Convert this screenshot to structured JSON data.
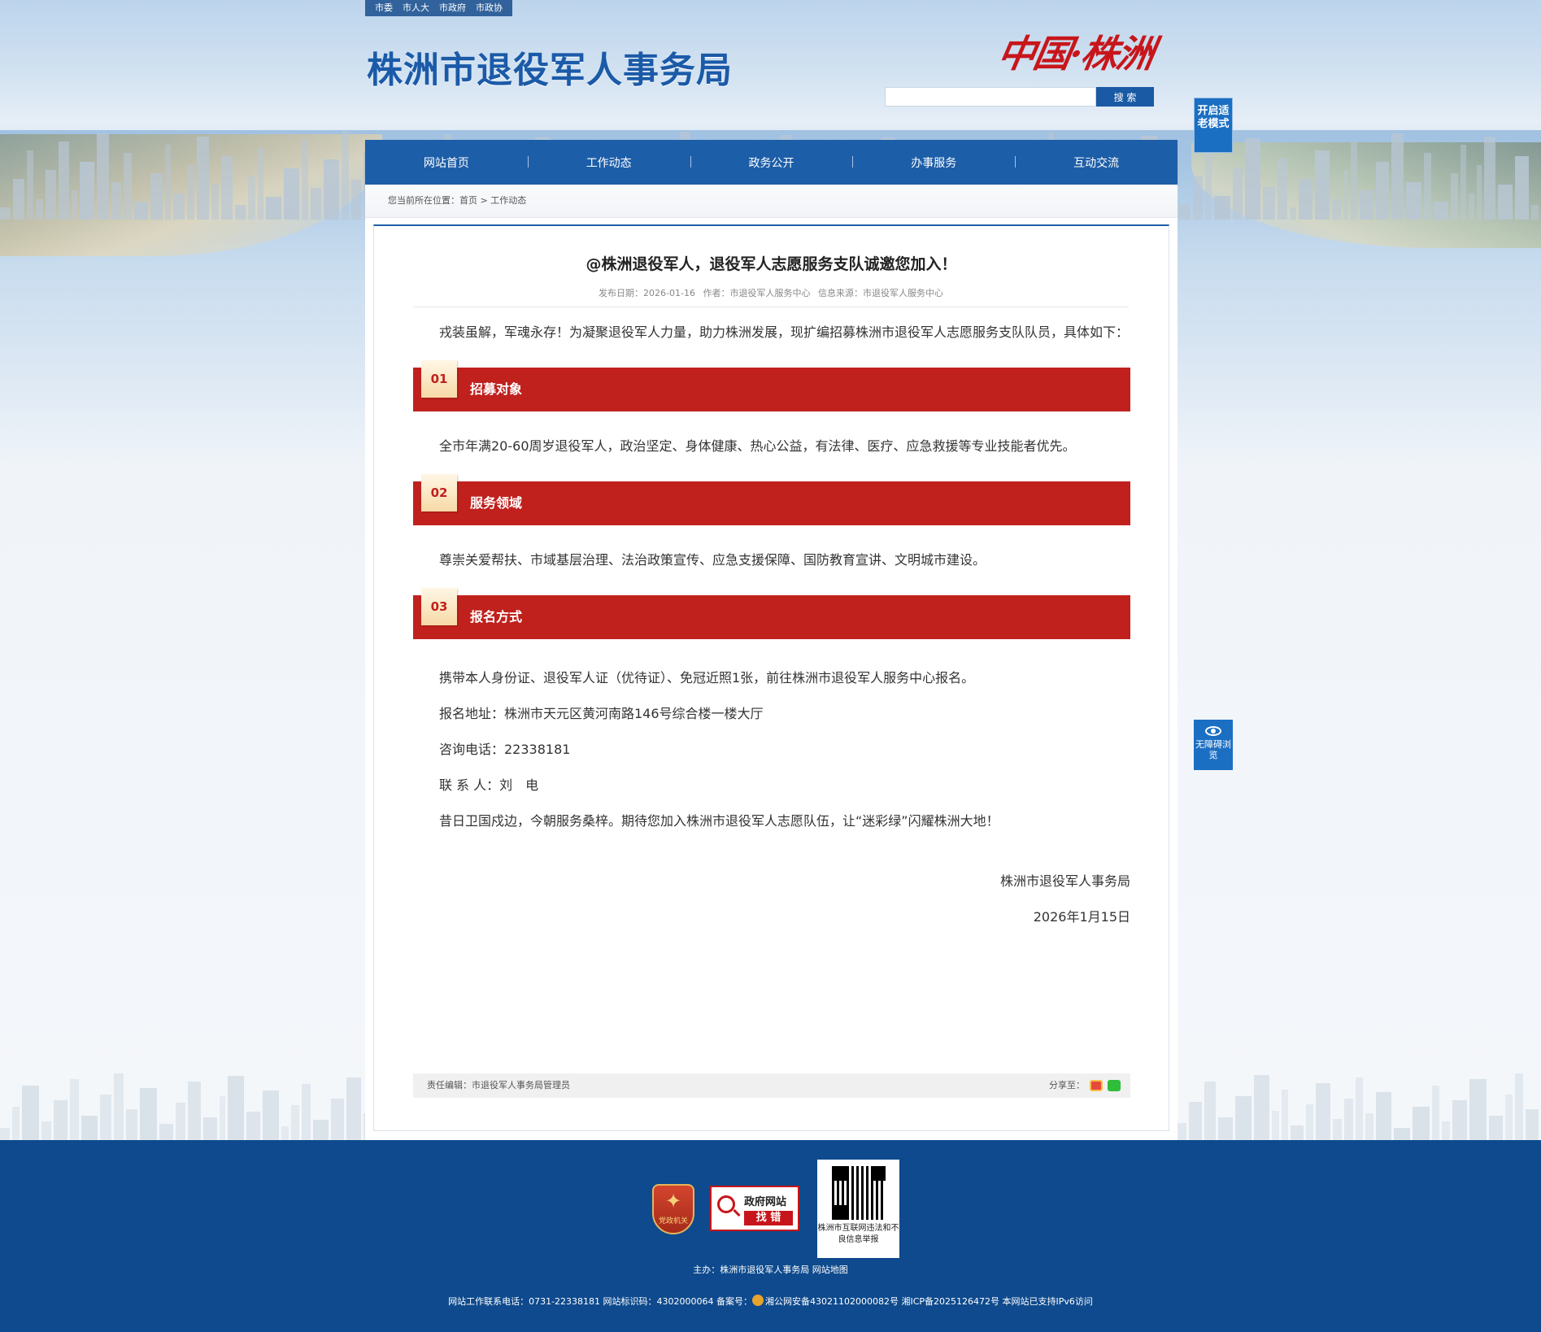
{
  "colors": {
    "brand_blue": "#1d5ea8",
    "accent_red": "#c0211d",
    "footer_blue": "#0e4a8d"
  },
  "top_links": [
    "市委",
    "市人大",
    "市政府",
    "市政协"
  ],
  "site_title": "株洲市退役军人事务局",
  "logo_text": "中国·株洲",
  "search": {
    "placeholder": "",
    "button": "搜 索"
  },
  "elder_mode": "开启适老模式",
  "nav": [
    "网站首页",
    "工作动态",
    "政务公开",
    "办事服务",
    "互动交流"
  ],
  "breadcrumb": {
    "prefix": "您当前所在位置：",
    "home": "首页",
    "sep": " > ",
    "current": "工作动态"
  },
  "article": {
    "title": "@株洲退役军人，退役军人志愿服务支队诚邀您加入！",
    "meta": {
      "date": "发布日期：2026-01-16",
      "author": "作者：市退役军人服务中心",
      "source": "信息来源：市退役军人服务中心"
    },
    "intro": "戎装虽解，军魂永存！为凝聚退役军人力量，助力株洲发展，现扩编招募株洲市退役军人志愿服务支队队员，具体如下：",
    "sections": [
      {
        "num": "01",
        "label": "招募对象",
        "text": "全市年满20-60周岁退役军人，政治坚定、身体健康、热心公益，有法律、医疗、应急救援等专业技能者优先。"
      },
      {
        "num": "02",
        "label": "服务领域",
        "text": "尊崇关爱帮扶、市域基层治理、法治政策宣传、应急支援保障、国防教育宣讲、文明城市建设。"
      },
      {
        "num": "03",
        "label": "报名方式",
        "lines": [
          "携带本人身份证、退役军人证（优待证）、免冠近照1张，前往株洲市退役军人服务中心报名。",
          "报名地址：株洲市天元区黄河南路146号综合楼一楼大厅",
          "咨询电话：22338181",
          "联 系 人：刘　电",
          "昔日卫国戍边，今朝服务桑梓。期待您加入株洲市退役军人志愿队伍，让“迷彩绿”闪耀株洲大地！"
        ]
      }
    ],
    "signature": "株洲市退役军人事务局",
    "sign_date": "2026年1月15日",
    "editor": "责任编辑：市退役军人事务局管理员",
    "share": "分享至："
  },
  "accessibility": "无障碍浏览",
  "footer": {
    "badge": "党政机关",
    "findbug": {
      "line1": "政府网站",
      "line2": "找 错"
    },
    "qr_caption": "株洲市互联网违法和不良信息举报",
    "host": "主办：株洲市退役军人事务局 网站地图",
    "info": "网站工作联系电话：0731-22338181 网站标识码：4302000064 备案号：",
    "info2": "湘公网安备43021102000082号 湘ICP备2025126472号 本网站已支持IPv6访问"
  }
}
